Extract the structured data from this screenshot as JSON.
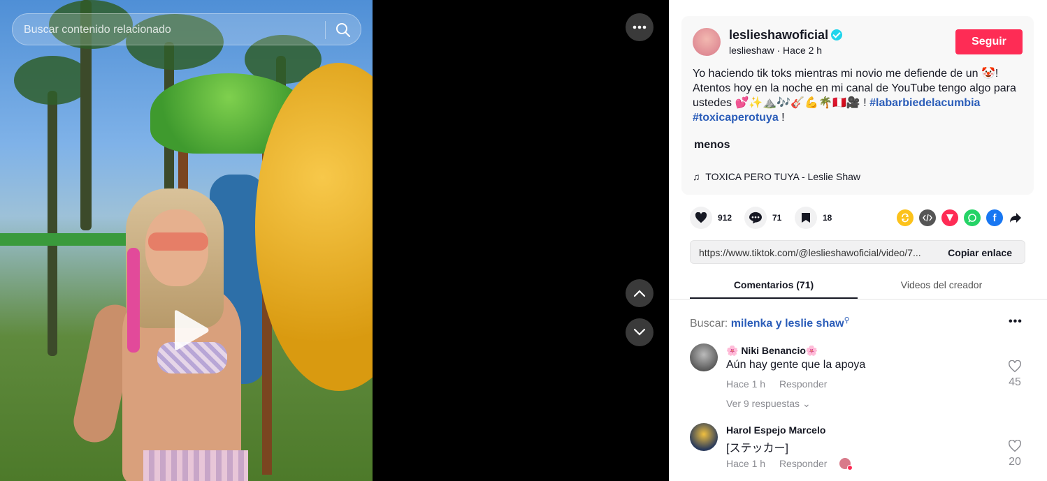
{
  "video": {
    "search_placeholder": "Buscar contenido relacionado"
  },
  "author": {
    "username": "leslieshawoficial",
    "handle": "leslieshaw",
    "time": "Hace 2 h",
    "follow_label": "Seguir"
  },
  "caption": {
    "text": "Yo haciendo tik toks mientras mi novio me defiende de un 🤡! Atentos hoy en la noche en mi canal de YouTube tengo algo para ustedes 💕✨⛰️🎶🎸💪🌴🇵🇪🎥 !",
    "hashtag1": "#labarbiedelacumbia",
    "hashtag2": "#toxicaperotuya",
    "end": " !",
    "less_label": "menos",
    "music": "TOXICA PERO TUYA - Leslie Shaw"
  },
  "actions": {
    "likes": "912",
    "comments": "71",
    "saves": "18"
  },
  "link": {
    "url": "https://www.tiktok.com/@leslieshawoficial/video/7...",
    "copy_label": "Copiar enlace"
  },
  "tabs": [
    {
      "label": "Comentarios (71)"
    },
    {
      "label": "Videos del creador"
    }
  ],
  "related_search": {
    "prefix": "Buscar:",
    "query": "milenka y leslie shaw"
  },
  "comments": [
    {
      "name": "🌸 Niki Benancio🌸",
      "text": "Aún hay gente que la apoya",
      "time": "Hace 1 h",
      "reply_label": "Responder",
      "likes": "45",
      "replies": "Ver 9 respuestas"
    },
    {
      "name": "Harol Espejo Marcelo",
      "text": "[ステッカー]",
      "time": "Hace 1 h",
      "reply_label": "Responder",
      "likes": "20"
    }
  ]
}
